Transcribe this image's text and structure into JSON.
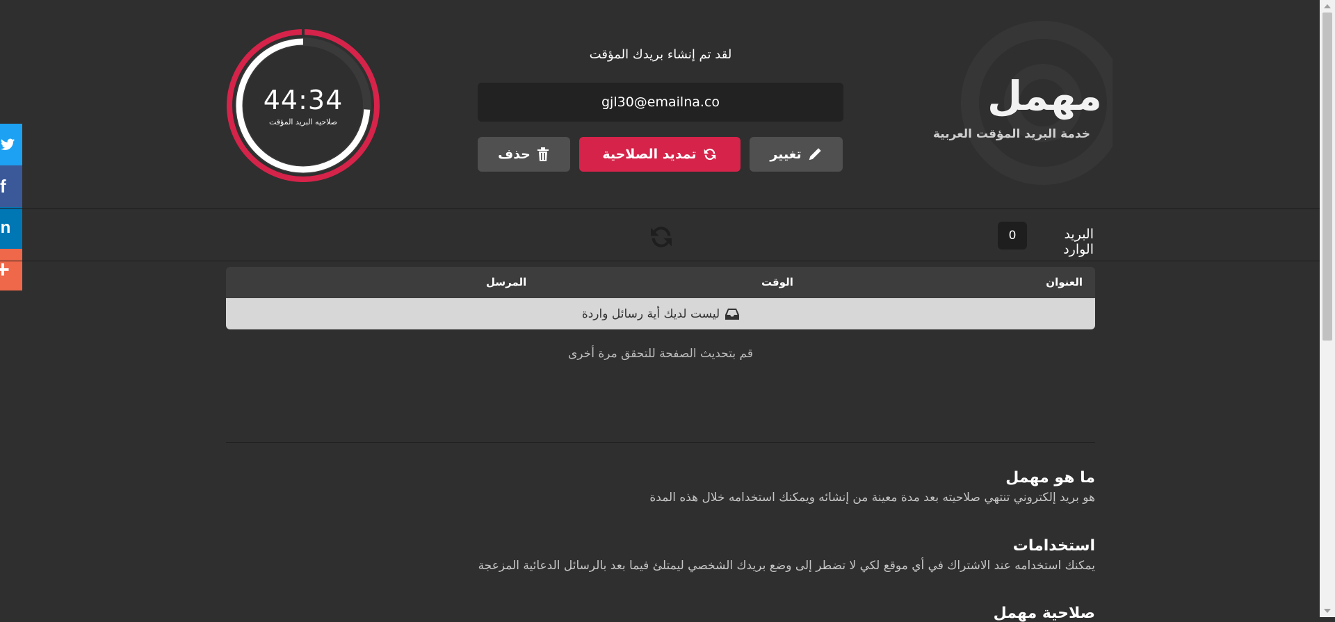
{
  "social": {
    "twitter_glyph": "t",
    "facebook_glyph": "f",
    "linkedin_glyph": "in",
    "more_glyph": "+",
    "colors": {
      "twitter": "#1da1f2",
      "facebook": "#3b5998",
      "linkedin": "#0077b5",
      "more": "#ef6849"
    }
  },
  "header": {
    "timer": "44:34",
    "timer_label": "صلاحيه البريد المؤقت",
    "timer_remaining_fraction": 0.74,
    "created_message": "لقد تم إنشاء بريدك المؤقت",
    "email": "gjl30@emailna.co",
    "buttons": {
      "delete": "حذف",
      "extend": "تمديد الصلاحية",
      "change": "تغيير"
    },
    "logo": "مهمل",
    "logo_subtitle": "خدمة البريد المؤقت العربية",
    "accent_color": "#d6234a"
  },
  "inbox": {
    "label": "البريد الوارد",
    "count": "0"
  },
  "table": {
    "columns": [
      "العنوان",
      "الوقت",
      "المرسل"
    ],
    "empty_message": "ليست لديك أية رسائل واردة",
    "refresh_hint": "قم بتحديث الصفحة للتحقق مرة أخرى"
  },
  "sections": [
    {
      "title": "ما هو مهمل",
      "text": "هو بريد إلكتروني تنتهي صلاحيته بعد مدة معينة من إنشائه ويمكنك استخدامه خلال هذه المدة"
    },
    {
      "title": "استخدامات",
      "text": "يمكنك استخدامه عند الاشتراك في أي موقع لكي لا تضطر إلى وضع بريدك الشخصي ليمتلئ فيما بعد بالرسائل الدعائية المزعجة"
    },
    {
      "title": "صلاحية مهمل",
      "text": ""
    }
  ]
}
